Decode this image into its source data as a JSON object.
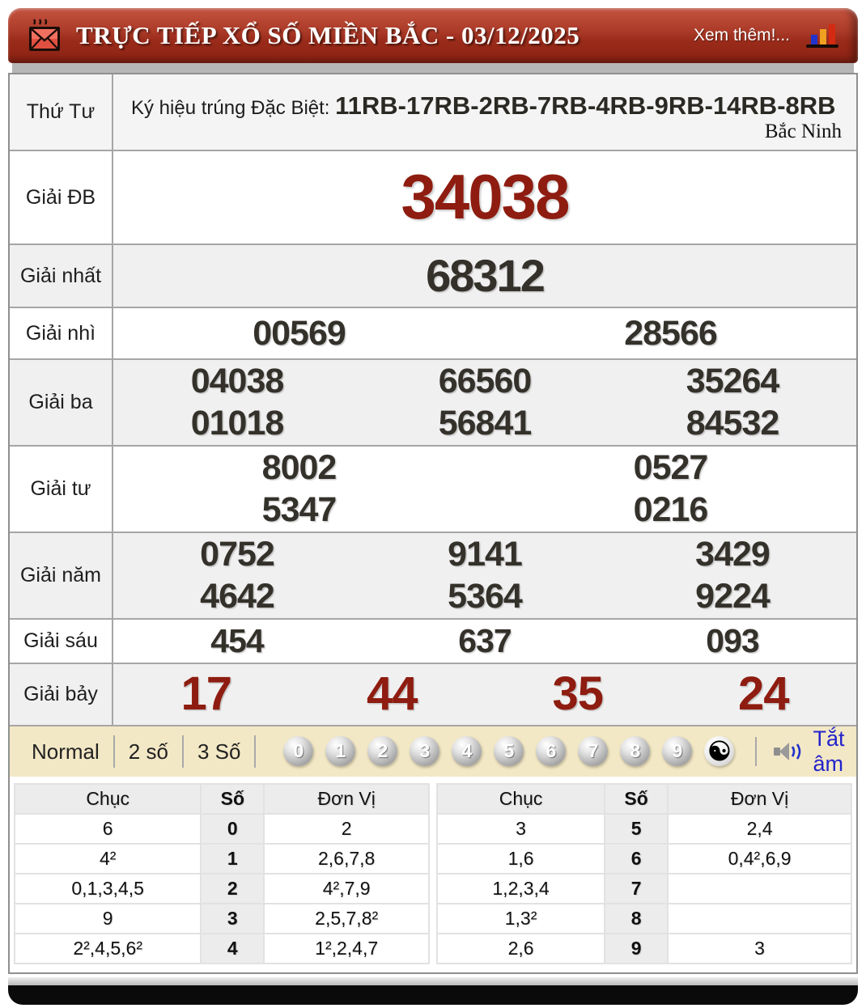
{
  "header": {
    "title": "TRỰC TIẾP XỔ SỐ MIỀN BẮC - 03/12/2025",
    "more_link": "Xem thêm!..."
  },
  "info": {
    "day": "Thứ Tư",
    "symbol_label": "Ký hiệu trúng Đặc Biệt:",
    "symbol_value": "11RB-17RB-2RB-7RB-4RB-9RB-14RB-8RB",
    "province": "Bắc Ninh"
  },
  "prizes": [
    {
      "label": "Giải ĐB",
      "rows": [
        [
          "34038"
        ]
      ]
    },
    {
      "label": "Giải nhất",
      "rows": [
        [
          "68312"
        ]
      ]
    },
    {
      "label": "Giải nhì",
      "rows": [
        [
          "00569",
          "28566"
        ]
      ]
    },
    {
      "label": "Giải ba",
      "rows": [
        [
          "04038",
          "66560",
          "35264"
        ],
        [
          "01018",
          "56841",
          "84532"
        ]
      ]
    },
    {
      "label": "Giải tư",
      "rows": [
        [
          "8002",
          "0527"
        ],
        [
          "5347",
          "0216"
        ]
      ]
    },
    {
      "label": "Giải năm",
      "rows": [
        [
          "0752",
          "9141",
          "3429"
        ],
        [
          "4642",
          "5364",
          "9224"
        ]
      ]
    },
    {
      "label": "Giải sáu",
      "rows": [
        [
          "454",
          "637",
          "093"
        ]
      ]
    },
    {
      "label": "Giải bảy",
      "rows": [
        [
          "17",
          "44",
          "35",
          "24"
        ]
      ]
    }
  ],
  "controls": {
    "modes": [
      "Normal",
      "2 số",
      "3 Số"
    ],
    "digits": [
      "0",
      "1",
      "2",
      "3",
      "4",
      "5",
      "6",
      "7",
      "8",
      "9"
    ],
    "yinyang": "☯",
    "mute_label": "Tắt âm"
  },
  "summary": {
    "headers": [
      "Chục",
      "Số",
      "Đơn Vị"
    ],
    "left": [
      [
        "6",
        "0",
        "2"
      ],
      [
        "4²",
        "1",
        "2,6,7,8"
      ],
      [
        "0,1,3,4,5",
        "2",
        "4²,7,9"
      ],
      [
        "9",
        "3",
        "2,5,7,8²"
      ],
      [
        "2²,4,5,6²",
        "4",
        "1²,2,4,7"
      ]
    ],
    "right": [
      [
        "3",
        "5",
        "2,4"
      ],
      [
        "1,6",
        "6",
        "0,4²,6,9"
      ],
      [
        "1,2,3,4",
        "7",
        ""
      ],
      [
        "1,3²",
        "8",
        ""
      ],
      [
        "2,6",
        "9",
        "3"
      ]
    ]
  },
  "colors": {
    "accent_red": "#8e1c10",
    "header_red": "#9a2b1a",
    "number_dark": "#34312b",
    "control_bg": "#f3e8c5",
    "link_blue": "#2323cc"
  }
}
